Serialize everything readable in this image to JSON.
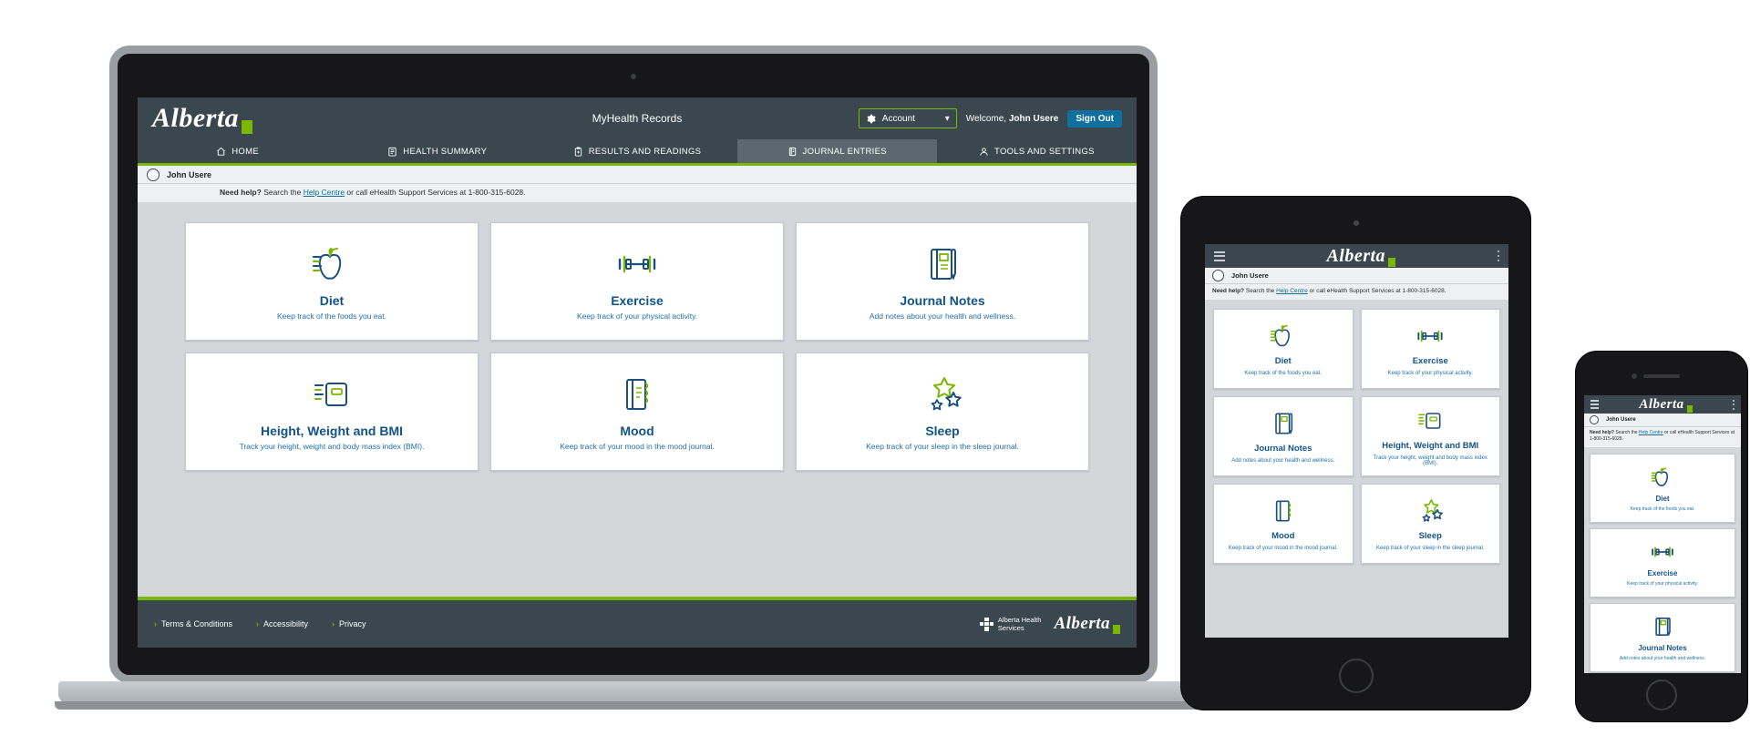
{
  "site": {
    "brand": "Alberta",
    "title": "MyHealth Records",
    "account_label": "Account",
    "welcome_prefix": "Welcome,",
    "welcome_name": "John Usere",
    "signout_label": "Sign Out",
    "username": "John Usere",
    "help_pre": "Need help?",
    "help_mid": "Search the",
    "help_link": "Help Centre",
    "help_post": "or call eHealth Support Services at 1-800-315-6028."
  },
  "nav": [
    {
      "label": "HOME",
      "icon": "home-icon",
      "active": false
    },
    {
      "label": "HEALTH SUMMARY",
      "icon": "clipboard-icon",
      "active": false
    },
    {
      "label": "RESULTS AND READINGS",
      "icon": "results-icon",
      "active": false
    },
    {
      "label": "JOURNAL ENTRIES",
      "icon": "journal-icon",
      "active": true
    },
    {
      "label": "TOOLS AND SETTINGS",
      "icon": "user-gear-icon",
      "active": false
    }
  ],
  "cards": [
    {
      "id": "diet",
      "icon": "apple-icon",
      "title": "Diet",
      "sub": "Keep track of the foods you eat."
    },
    {
      "id": "exercise",
      "icon": "dumbbell-icon",
      "title": "Exercise",
      "sub": "Keep track of your physical activity."
    },
    {
      "id": "journal",
      "icon": "notebook-pen-icon",
      "title": "Journal Notes",
      "sub": "Add notes about your health and wellness."
    },
    {
      "id": "bmi",
      "icon": "scale-icon",
      "title": "Height, Weight and BMI",
      "sub": "Track your height, weight and body mass index (BMI)."
    },
    {
      "id": "mood",
      "icon": "mood-book-icon",
      "title": "Mood",
      "sub": "Keep track of your mood in the mood journal."
    },
    {
      "id": "sleep",
      "icon": "stars-icon",
      "title": "Sleep",
      "sub": "Keep track of your sleep in the sleep journal."
    }
  ],
  "footer": {
    "links": [
      "Terms & Conditions",
      "Accessibility",
      "Privacy"
    ],
    "ahs_line1": "Alberta Health",
    "ahs_line2": "Services",
    "ahs_brand": "Alberta"
  },
  "colors": {
    "header_bg": "#3b474f",
    "accent_green": "#7ab800",
    "link_blue": "#0f6f9e",
    "title_blue": "#12538a",
    "page_bg": "#d3d7da"
  }
}
